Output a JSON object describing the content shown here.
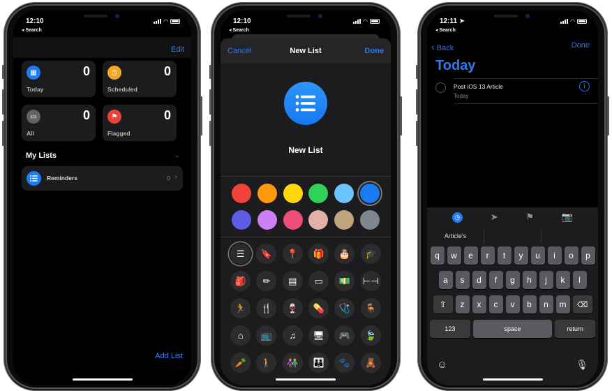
{
  "phones": [
    {
      "status": {
        "time": "12:10",
        "back_label": "◂ Search"
      },
      "nav": {
        "edit_label": "Edit"
      },
      "smart_lists": [
        {
          "label": "Today",
          "count": "0",
          "icon": "calendar-icon",
          "color": "#1e7bf4"
        },
        {
          "label": "Scheduled",
          "count": "0",
          "icon": "clock-icon",
          "color": "#f5a623"
        },
        {
          "label": "All",
          "count": "0",
          "icon": "tray-icon",
          "color": "#636366"
        },
        {
          "label": "Flagged",
          "count": "0",
          "icon": "flag-icon",
          "color": "#e9423a"
        }
      ],
      "my_lists_header": "My Lists",
      "lists": [
        {
          "name": "Reminders",
          "count": "0",
          "icon": "list-bullet-icon",
          "color": "#1e7bf4"
        }
      ],
      "add_list_label": "Add List"
    },
    {
      "status": {
        "time": "12:10",
        "back_label": "◂ Search"
      },
      "nav": {
        "cancel_label": "Cancel",
        "title": "New List",
        "done_label": "Done"
      },
      "list_name": "New List",
      "selected_color": "#1a7cf5",
      "colors": [
        "#f2423a",
        "#fe9a0c",
        "#ffd60a",
        "#30d158",
        "#6ac4fd",
        "#1a7cf5",
        "#5e5ce6",
        "#cf7ff5",
        "#f14d7a",
        "#e1b0a8",
        "#c1a37c",
        "#7f868d"
      ],
      "glyphs": [
        {
          "name": "list-bullet-icon",
          "char": "☰",
          "selected": true
        },
        {
          "name": "bookmark-icon",
          "char": "🔖"
        },
        {
          "name": "pin-icon",
          "char": "📍"
        },
        {
          "name": "gift-icon",
          "char": "🎁"
        },
        {
          "name": "birthday-cake-icon",
          "char": "🎂"
        },
        {
          "name": "graduation-cap-icon",
          "char": "🎓"
        },
        {
          "name": "backpack-icon",
          "char": "🎒"
        },
        {
          "name": "pencil-ruler-icon",
          "char": "✏"
        },
        {
          "name": "wallet-icon",
          "char": "▤"
        },
        {
          "name": "credit-card-icon",
          "char": "▭"
        },
        {
          "name": "money-icon",
          "char": "💵"
        },
        {
          "name": "dumbbell-icon",
          "char": "⊢⊣"
        },
        {
          "name": "running-figure-icon",
          "char": "🏃"
        },
        {
          "name": "fork-knife-icon",
          "char": "🍴"
        },
        {
          "name": "wine-glass-icon",
          "char": "🍷"
        },
        {
          "name": "pills-icon",
          "char": "💊"
        },
        {
          "name": "stethoscope-icon",
          "char": "🩺"
        },
        {
          "name": "chair-icon",
          "char": "🪑"
        },
        {
          "name": "house-icon",
          "char": "⌂"
        },
        {
          "name": "tv-icon",
          "char": "📺"
        },
        {
          "name": "music-note-icon",
          "char": "♫"
        },
        {
          "name": "computer-icon",
          "char": "🖥"
        },
        {
          "name": "game-controller-icon",
          "char": "🎮"
        },
        {
          "name": "leaf-icon",
          "char": "🍃"
        },
        {
          "name": "carrot-icon",
          "char": "🥕"
        },
        {
          "name": "person-icon",
          "char": "🚶"
        },
        {
          "name": "two-people-icon",
          "char": "👫"
        },
        {
          "name": "family-icon",
          "char": "👪"
        },
        {
          "name": "paw-print-icon",
          "char": "🐾"
        },
        {
          "name": "teddy-bear-icon",
          "char": "🧸"
        }
      ]
    },
    {
      "status": {
        "time": "12:11 ➤",
        "back_label": "◂ Search"
      },
      "nav": {
        "back_label": "Back",
        "done_label": "Done"
      },
      "title": "Today",
      "todo": {
        "title": "Post iOS 13 Article",
        "subtitle": "Today"
      },
      "toolbar": [
        "clock-icon",
        "location-arrow-icon",
        "flag-icon",
        "camera-icon"
      ],
      "suggestions": [
        "Article's",
        "",
        ""
      ],
      "keyboard": {
        "row1": [
          "q",
          "w",
          "e",
          "r",
          "t",
          "y",
          "u",
          "i",
          "o",
          "p"
        ],
        "row2": [
          "a",
          "s",
          "d",
          "f",
          "g",
          "h",
          "j",
          "k",
          "l"
        ],
        "row3": [
          "z",
          "x",
          "c",
          "v",
          "b",
          "n",
          "m"
        ],
        "numbers_label": "123",
        "space_label": "space",
        "return_label": "return"
      }
    }
  ]
}
